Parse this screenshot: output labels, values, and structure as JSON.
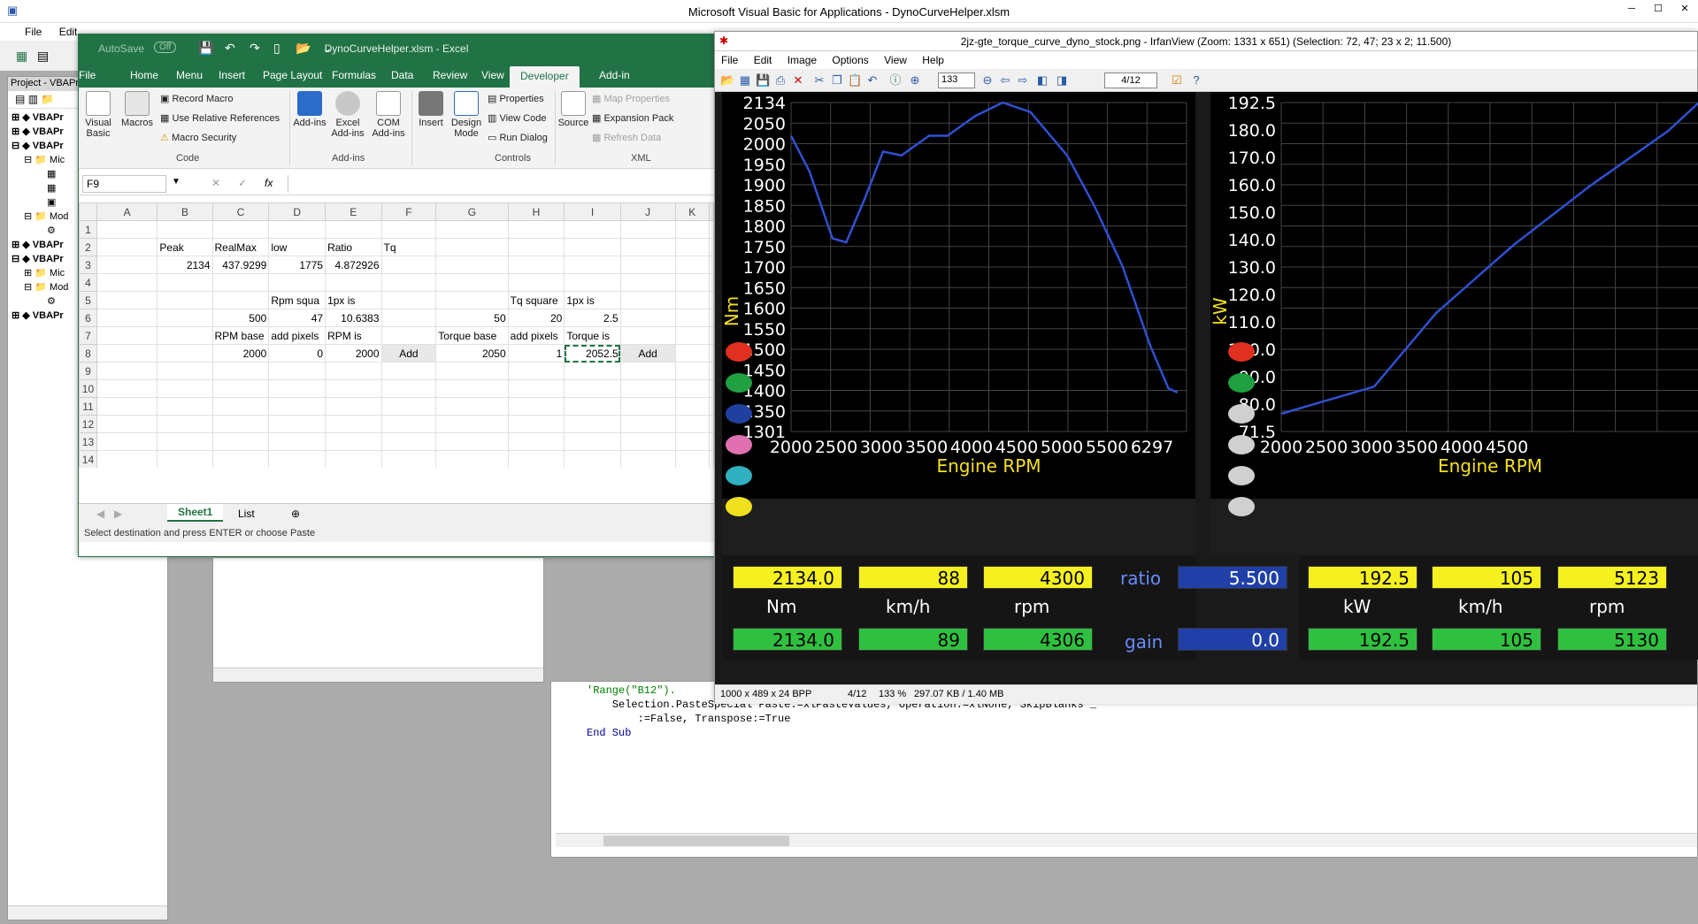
{
  "vbe": {
    "title": "Microsoft Visual Basic for Applications - DynoCurveHelper.xlsm",
    "menu": [
      "File",
      "Edit"
    ],
    "project_title": "Project - VBAPr",
    "tree": [
      "VBAPr",
      "VBAPr",
      "VBAPr",
      "Mic",
      "Mod",
      "VBAPr",
      "VBAPr",
      "Mic",
      "Mod",
      "VBAPr"
    ],
    "code": [
      "'Range(\"B12\").",
      "Selection.PasteSpecial Paste:=xlPasteValues, Operation:=xlNone, SkipBlanks _",
      "    :=False, Transpose:=True",
      "End Sub"
    ]
  },
  "excel": {
    "title": "DynoCurveHelper.xlsm  -  Excel",
    "autosave": "AutoSave",
    "autosave_state": "Off",
    "tabs": [
      "File",
      "Home",
      "Menu",
      "Insert",
      "Page Layout",
      "Formulas",
      "Data",
      "Review",
      "View",
      "Developer",
      "Add-in"
    ],
    "active_tab": "Developer",
    "ribbon": {
      "visual_basic": "Visual Basic",
      "macros": "Macros",
      "record_macro": "Record Macro",
      "relative_refs": "Use Relative References",
      "macro_security": "Macro Security",
      "code_group": "Code",
      "addins": "Add-ins",
      "excel_addins": "Excel Add-ins",
      "com_addins": "COM Add-ins",
      "addins_group": "Add-ins",
      "insert": "Insert",
      "design_mode": "Design Mode",
      "properties": "Properties",
      "view_code": "View Code",
      "run_dialog": "Run Dialog",
      "controls_group": "Controls",
      "source": "Source",
      "map_properties": "Map Properties",
      "expansion_packs": "Expansion Pack",
      "refresh_data": "Refresh Data",
      "xml_group": "XML"
    },
    "namebox": "F9",
    "fx": "fx",
    "columns": [
      "A",
      "B",
      "C",
      "D",
      "E",
      "F",
      "G",
      "H",
      "I",
      "J",
      "K"
    ],
    "rows": [
      [
        "",
        "",
        "",
        "",
        "",
        "",
        "",
        "",
        "",
        "",
        ""
      ],
      [
        "",
        "Peak",
        "RealMax",
        "low",
        "Ratio",
        "Tq",
        "",
        "",
        "",
        "",
        ""
      ],
      [
        "",
        "2134",
        "437.9299",
        "1775",
        "4.872926",
        "",
        "",
        "",
        "",
        "",
        ""
      ],
      [
        "",
        "",
        "",
        "",
        "",
        "",
        "",
        "",
        "",
        "",
        ""
      ],
      [
        "",
        "",
        "",
        "Rpm squa",
        "1px is",
        "",
        "",
        "Tq square",
        "1px is",
        "",
        ""
      ],
      [
        "",
        "",
        "500",
        "47",
        "10.6383",
        "",
        "50",
        "20",
        "2.5",
        "",
        ""
      ],
      [
        "",
        "",
        "RPM base",
        "add pixels",
        "RPM is",
        "",
        "Torque base",
        "add pixels",
        "Torque is",
        "",
        ""
      ],
      [
        "",
        "",
        "2000",
        "0",
        "2000",
        "",
        "2050",
        "1",
        "2052.5",
        "",
        ""
      ],
      [
        "",
        "",
        "",
        "",
        "",
        "",
        "",
        "",
        "",
        "",
        ""
      ],
      [
        "",
        "",
        "",
        "",
        "",
        "",
        "",
        "",
        "",
        "",
        ""
      ],
      [
        "",
        "",
        "",
        "",
        "",
        "",
        "",
        "",
        "",
        "",
        ""
      ],
      [
        "",
        "",
        "",
        "",
        "",
        "",
        "",
        "",
        "",
        "",
        ""
      ],
      [
        "",
        "",
        "",
        "",
        "",
        "",
        "",
        "",
        "",
        "",
        ""
      ],
      [
        "",
        "",
        "",
        "",
        "",
        "",
        "",
        "",
        "",
        "",
        ""
      ],
      [
        "",
        "",
        "",
        "",
        "",
        "",
        "",
        "",
        "",
        "",
        ""
      ],
      [
        "",
        "",
        "",
        "",
        "",
        "",
        "",
        "",
        "",
        "",
        ""
      ]
    ],
    "add_button": "Add",
    "sheets": [
      "Sheet1",
      "List"
    ],
    "status": "Select destination and press ENTER or choose Paste"
  },
  "irfan": {
    "title": "2jz-gte_torque_curve_dyno_stock.png - IrfanView (Zoom: 1331 x 651) (Selection: 72, 47; 23 x 2; 11.500)",
    "menu": [
      "File",
      "Edit",
      "Image",
      "Options",
      "View",
      "Help"
    ],
    "zoom": "133",
    "page": "4/12",
    "status": [
      "1000 x 489 x 24 BPP",
      "4/12",
      "133 %",
      "297.07 KB / 1.40 MB"
    ],
    "torque_chart": {
      "ylabel": "Nm",
      "xlabel": "Engine RPM",
      "y_ticks": [
        "2134",
        "2050",
        "2000",
        "1950",
        "1900",
        "1850",
        "1800",
        "1750",
        "1700",
        "1650",
        "1600",
        "1550",
        "1500",
        "1450",
        "1400",
        "1350",
        "1301"
      ],
      "x_ticks": [
        "2000",
        "2500",
        "3000",
        "3500",
        "4000",
        "4500",
        "5000",
        "5500",
        "6297"
      ]
    },
    "power_chart": {
      "ylabel": "kW",
      "xlabel": "Engine RPM",
      "y_ticks": [
        "192.5",
        "180.0",
        "170.0",
        "160.0",
        "150.0",
        "140.0",
        "130.0",
        "120.0",
        "110.0",
        "100.0",
        "90.0",
        "80.0",
        "71.5"
      ],
      "x_ticks": [
        "2000",
        "2500",
        "3000",
        "3500",
        "4000",
        "4500"
      ]
    },
    "readouts": {
      "nm_top": "2134.0",
      "kmh_top": "88",
      "rpm_top": "4300",
      "ratio_label": "ratio",
      "ratio": "5.500",
      "nm_label": "Nm",
      "kmh_label": "km/h",
      "rpm_label": "rpm",
      "nm_bot": "2134.0",
      "kmh_bot": "89",
      "rpm_bot": "4306",
      "gain_label": "gain",
      "gain": "0.0",
      "kw_top": "192.5",
      "kmh2_top": "105",
      "rpm2_top": "5123",
      "kw_label": "kW",
      "kmh2_label": "km/h",
      "rpm2_label": "rpm",
      "kw_bot": "192.5",
      "kmh2_bot": "105",
      "rpm2_bot": "5130"
    }
  },
  "chart_data": [
    {
      "type": "line",
      "series": [
        {
          "name": "",
          "x": [
            2000,
            2200,
            2450,
            2600,
            2800,
            3000,
            3200,
            3500,
            3700,
            4000,
            4300,
            4600,
            5000,
            5300,
            5600,
            5900,
            6100,
            6200
          ],
          "y": [
            2050,
            1960,
            1790,
            1780,
            1890,
            2010,
            2000,
            2050,
            2050,
            2100,
            2134,
            2110,
            2000,
            1870,
            1720,
            1520,
            1410,
            1400
          ]
        }
      ],
      "xlim": [
        2000,
        6297
      ],
      "ylim": [
        1301,
        2134
      ],
      "xlabel": "Engine RPM",
      "ylabel": "Nm"
    },
    {
      "type": "line",
      "series": [
        {
          "name": "",
          "x": [
            2000,
            2300,
            2600,
            3000,
            3500,
            4000,
            4500,
            4700
          ],
          "y": [
            78,
            83,
            88,
            115,
            140,
            162,
            182,
            192.5
          ]
        }
      ],
      "xlim": [
        2000,
        4700
      ],
      "ylim": [
        71.5,
        192.5
      ],
      "xlabel": "Engine RPM",
      "ylabel": "kW"
    }
  ]
}
